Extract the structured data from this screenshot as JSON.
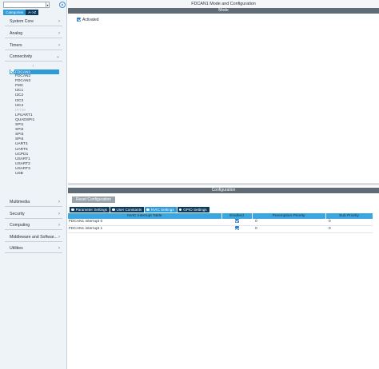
{
  "sidebar": {
    "search": {
      "value": "",
      "placeholder": ""
    },
    "tabs": {
      "categories": "Categories",
      "atoz": "A->Z"
    },
    "categories": [
      {
        "label": "System Core",
        "chevron": "›"
      },
      {
        "label": "Analog",
        "chevron": "›"
      },
      {
        "label": "Timers",
        "chevron": "›"
      },
      {
        "label": "Connectivity",
        "chevron": "⌄"
      }
    ],
    "sort_icon": "↑",
    "peripherals": [
      {
        "label": "FDCAN1"
      },
      {
        "label": "FDCAN2"
      },
      {
        "label": "FDCAN3"
      },
      {
        "label": "FMC"
      },
      {
        "label": "I2C1"
      },
      {
        "label": "I2C2"
      },
      {
        "label": "I2C3"
      },
      {
        "label": "I2C4"
      },
      {
        "label": "IRTIM"
      },
      {
        "label": "LPUART1"
      },
      {
        "label": "QUADSPI1"
      },
      {
        "label": "SPI1"
      },
      {
        "label": "SPI2"
      },
      {
        "label": "SPI3"
      },
      {
        "label": "SPI4"
      },
      {
        "label": "UART4"
      },
      {
        "label": "UART5"
      },
      {
        "label": "UCPD1"
      },
      {
        "label": "USART1"
      },
      {
        "label": "USART2"
      },
      {
        "label": "USART3"
      },
      {
        "label": "USB"
      }
    ],
    "bottom_categories": [
      {
        "label": "Multimedia",
        "chevron": "›"
      },
      {
        "label": "Security",
        "chevron": "›"
      },
      {
        "label": "Computing",
        "chevron": "›"
      },
      {
        "label": "Middleware and Softwar...",
        "chevron": "›"
      },
      {
        "label": "Utilities",
        "chevron": "›"
      }
    ]
  },
  "main": {
    "title": "FDCAN1 Mode and Configuration",
    "mode_header": "Mode",
    "activated_label": "Activated",
    "config_header": "Configuration",
    "reset_button": "Reset Configuration",
    "config_tabs": [
      {
        "label": "Parameter Settings"
      },
      {
        "label": "User Constants"
      },
      {
        "label": "NVIC Settings"
      },
      {
        "label": "GPIO Settings"
      }
    ],
    "nvic_table": {
      "headers": [
        "NVIC Interrupt Table",
        "Enabled",
        "Preemption Priority",
        "Sub Priority"
      ],
      "rows": [
        {
          "name": "FDCAN1 interrupt 0",
          "enabled": "✓",
          "preemption": "0",
          "sub": "0"
        },
        {
          "name": "FDCAN1 interrupt 1",
          "enabled": "✓",
          "preemption": "0",
          "sub": "0"
        }
      ]
    }
  },
  "colors": {
    "accent": "#2f9ad8",
    "dark_tab": "#0d3a5c",
    "section_bar": "#5f6b77",
    "table_header": "#3aa7e0"
  },
  "icons": {
    "gear": "gear-icon",
    "checkbox": "checkbox-checked-icon",
    "chevron": "chevron-right-icon"
  }
}
